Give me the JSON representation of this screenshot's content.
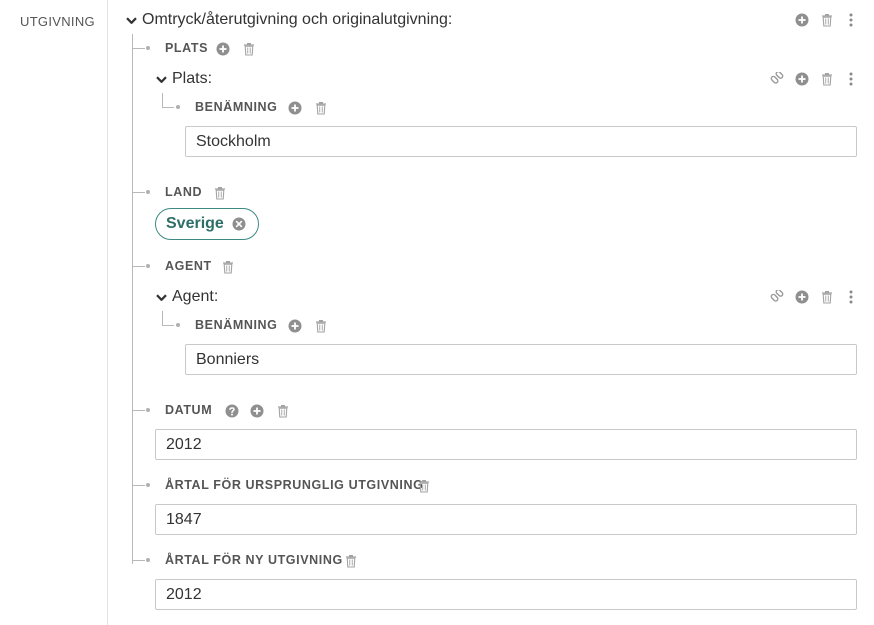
{
  "section_label": "UTGIVNING",
  "main_heading": "Omtryck/återutgivning och originalutgivning:",
  "plats": {
    "label": "PLATS",
    "sub_heading": "Plats:",
    "benamning_label": "BENÄMNING",
    "benamning_value": "Stockholm"
  },
  "land": {
    "label": "LAND",
    "tag": "Sverige"
  },
  "agent": {
    "label": "AGENT",
    "sub_heading": "Agent:",
    "benamning_label": "BENÄMNING",
    "benamning_value": "Bonniers"
  },
  "datum": {
    "label": "DATUM",
    "value": "2012"
  },
  "artal_ursprunglig": {
    "label": "ÅRTAL FÖR URSPRUNGLIG UTGIVNING",
    "value": "1847"
  },
  "artal_ny": {
    "label": "ÅRTAL FÖR NY UTGIVNING",
    "value": "2012"
  },
  "icons": [
    "chevron-down-icon",
    "add-icon",
    "trash-icon",
    "more-vertical-icon",
    "link-icon",
    "remove-icon",
    "help-icon"
  ],
  "colors": {
    "tag_border": "#3c8a83",
    "tag_text": "#2e6e68",
    "icon_gray": "#9a9a9a",
    "icon_dark": "#8a8a8a"
  }
}
